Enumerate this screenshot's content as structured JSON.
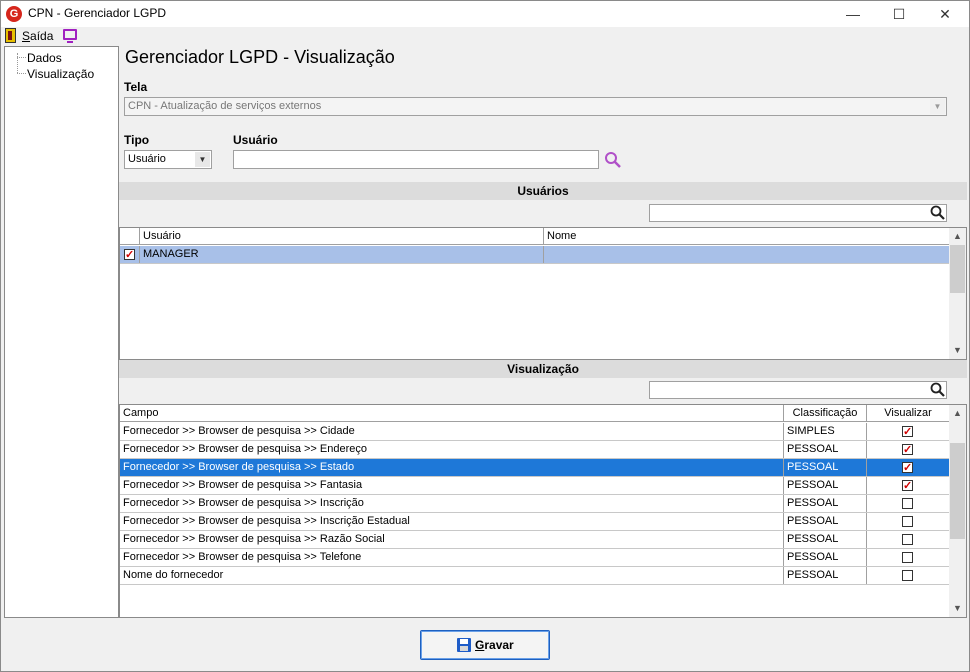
{
  "window": {
    "title": "CPN - Gerenciador LGPD",
    "logo": "G"
  },
  "menu": {
    "exit_label": "Saída",
    "exit_underline": "S",
    "exit_rest": "aída"
  },
  "tree": {
    "items": [
      "Dados",
      "Visualização"
    ]
  },
  "page_title": "Gerenciador LGPD - Visualização",
  "form": {
    "tela_label": "Tela",
    "tela_value": "CPN - Atualização de serviços externos",
    "tipo_label": "Tipo",
    "tipo_value": "Usuário",
    "usuario_label": "Usuário",
    "usuario_value": ""
  },
  "users_section": {
    "header": "Usuários",
    "search_value": "",
    "columns": [
      "Usuário",
      "Nome"
    ],
    "rows": [
      {
        "checked": true,
        "usuario": "MANAGER",
        "nome": ""
      }
    ]
  },
  "view_section": {
    "header": "Visualização",
    "search_value": "",
    "columns": [
      "Campo",
      "Classificação",
      "Visualizar"
    ],
    "rows": [
      {
        "campo": "Fornecedor >> Browser de pesquisa >> Cidade",
        "classificacao": "SIMPLES",
        "visualizar": true
      },
      {
        "campo": "Fornecedor >> Browser de pesquisa >> Endereço",
        "classificacao": "PESSOAL",
        "visualizar": true
      },
      {
        "campo": "Fornecedor >> Browser de pesquisa >> Estado",
        "classificacao": "PESSOAL",
        "visualizar": true
      },
      {
        "campo": "Fornecedor >> Browser de pesquisa >> Fantasia",
        "classificacao": "PESSOAL",
        "visualizar": true
      },
      {
        "campo": "Fornecedor >> Browser de pesquisa >> Inscrição",
        "classificacao": "PESSOAL",
        "visualizar": false
      },
      {
        "campo": "Fornecedor >> Browser de pesquisa >> Inscrição Estadual",
        "classificacao": "PESSOAL",
        "visualizar": false
      },
      {
        "campo": "Fornecedor >> Browser de pesquisa >> Razão Social",
        "classificacao": "PESSOAL",
        "visualizar": false
      },
      {
        "campo": "Fornecedor >> Browser de pesquisa >> Telefone",
        "classificacao": "PESSOAL",
        "visualizar": false
      },
      {
        "campo": "Nome do fornecedor",
        "classificacao": "PESSOAL",
        "visualizar": false
      }
    ]
  },
  "save_button": {
    "underline": "G",
    "rest": "ravar"
  },
  "colors": {
    "selection": "#1e78d8",
    "user_selection": "#a8c0e8",
    "logo": "#d6261c",
    "accent_icon": "#a020c0"
  },
  "icons": [
    "app-logo-icon",
    "exit-door-icon",
    "monitor-icon",
    "search-icon",
    "floppy-disk-icon",
    "checkbox-icon"
  ]
}
